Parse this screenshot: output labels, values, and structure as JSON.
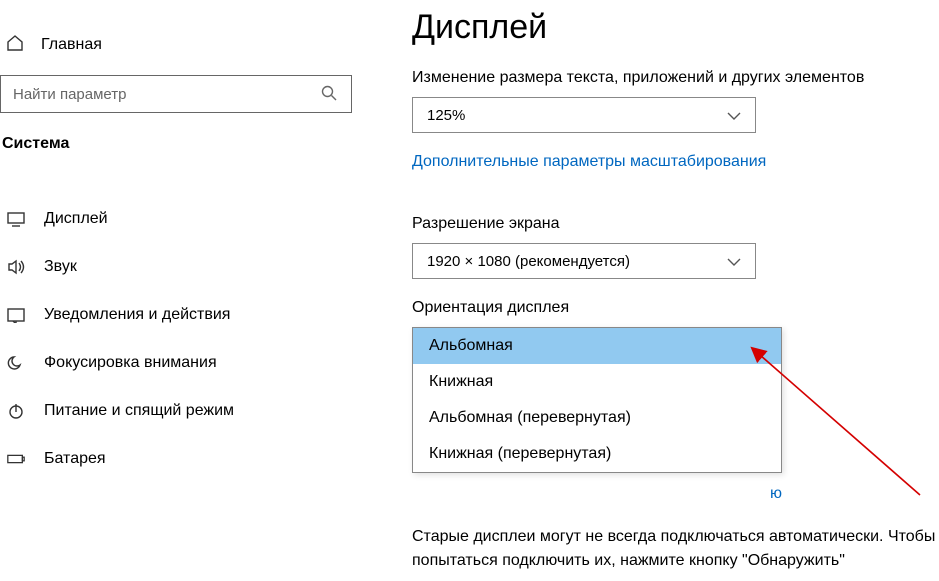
{
  "sidebar": {
    "home": "Главная",
    "search_placeholder": "Найти параметр",
    "section": "Система",
    "items": [
      {
        "label": "Дисплей"
      },
      {
        "label": "Звук"
      },
      {
        "label": "Уведомления и действия"
      },
      {
        "label": "Фокусировка внимания"
      },
      {
        "label": "Питание и спящий режим"
      },
      {
        "label": "Батарея"
      }
    ]
  },
  "main": {
    "title": "Дисплей",
    "scale_label": "Изменение размера текста, приложений и других элементов",
    "scale_value": "125%",
    "scale_link": "Дополнительные параметры масштабирования",
    "resolution_label": "Разрешение экрана",
    "resolution_value": "1920 × 1080 (рекомендуется)",
    "orientation_label": "Ориентация дисплея",
    "orientation_options": [
      "Альбомная",
      "Книжная",
      "Альбомная (перевернутая)",
      "Книжная (перевернутая)"
    ],
    "connect_tail": "ю",
    "old_text": "Старые дисплеи могут не всегда подключаться автоматически. Чтобы попытаться подключить их, нажмите кнопку \"Обнаружить\""
  }
}
